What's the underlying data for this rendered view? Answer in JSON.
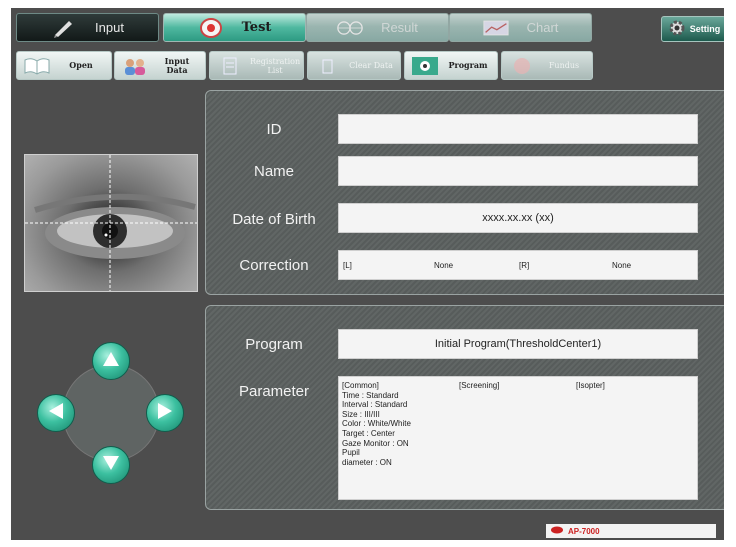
{
  "tabs": [
    {
      "label": "Input"
    },
    {
      "label": "Test"
    },
    {
      "label": "Result"
    },
    {
      "label": "Chart"
    }
  ],
  "setting": {
    "label": "Setting"
  },
  "toolbar": {
    "open": "Open",
    "input_data": "Input Data",
    "registration_list": "Registration List",
    "clear_data": "Clear Data",
    "program": "Program",
    "fundus": "Fundus"
  },
  "patient": {
    "id_label": "ID",
    "id_value": "",
    "name_label": "Name",
    "name_value": "",
    "dob_label": "Date of Birth",
    "dob_value": "xxxx.xx.xx (xx)",
    "correction_label": "Correction",
    "correction_left_label": "[L]",
    "correction_left_value": "None",
    "correction_right_label": "[R]",
    "correction_right_value": "None"
  },
  "program": {
    "program_label": "Program",
    "program_value": "Initial Program(ThresholdCenter1)",
    "parameter_label": "Parameter",
    "common_header": "[Common]",
    "screening_header": "[Screening]",
    "isopter_header": "[Isopter]",
    "common_lines": [
      "Time : Standard",
      "Interval : Standard",
      "Size : III/III",
      "Color : White/White",
      "Target : Center",
      "Gaze Monitor : ON",
      "Pupil",
      "diameter : ON"
    ]
  },
  "footer": {
    "model": "AP-7000"
  },
  "colors": {
    "accent": "#2d9a82",
    "background": "#4d4d4d"
  }
}
